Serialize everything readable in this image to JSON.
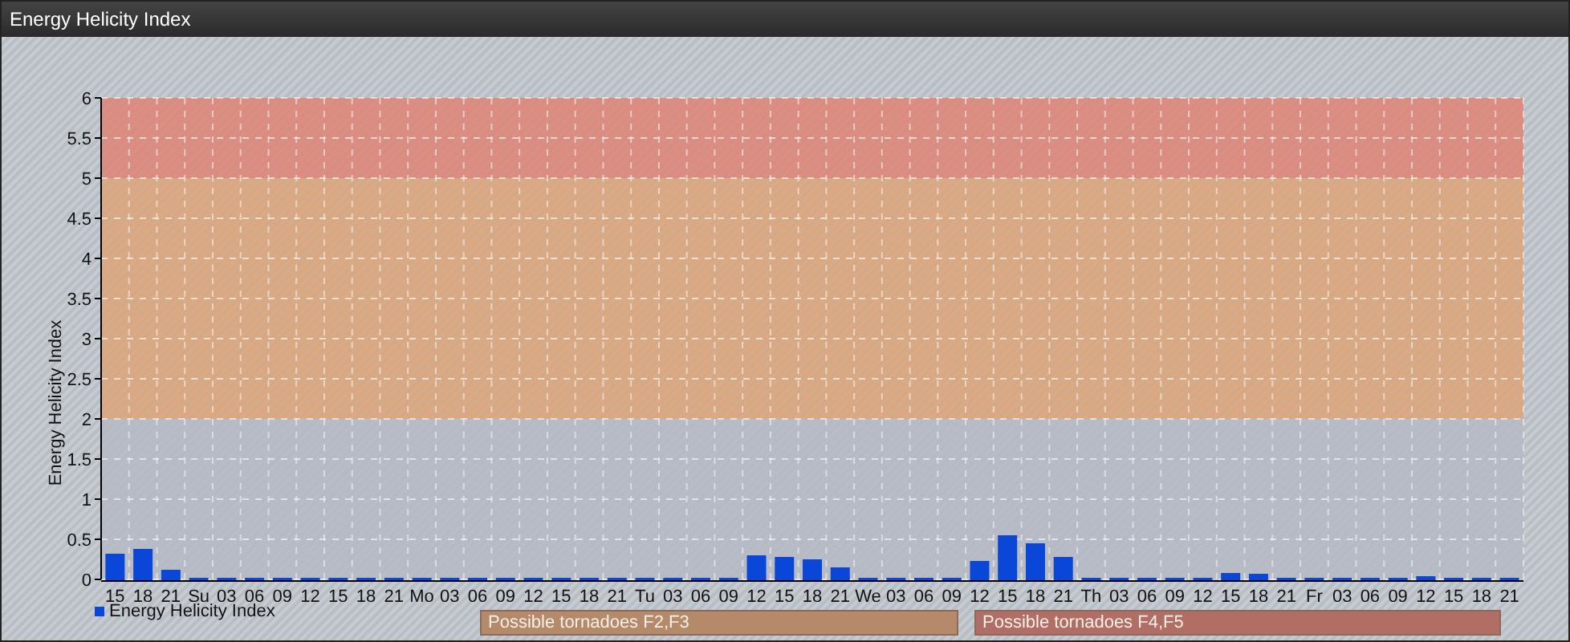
{
  "window": {
    "title": "Energy Helicity Index"
  },
  "chart": {
    "chart_data": {
      "type": "bar",
      "ylabel": "Energy Helicity Index",
      "categories": [
        "15",
        "18",
        "21",
        "Su",
        "03",
        "06",
        "09",
        "12",
        "15",
        "18",
        "21",
        "Mo",
        "03",
        "06",
        "09",
        "12",
        "15",
        "18",
        "21",
        "Tu",
        "03",
        "06",
        "09",
        "12",
        "15",
        "18",
        "21",
        "We",
        "03",
        "06",
        "09",
        "12",
        "15",
        "18",
        "21",
        "Th",
        "03",
        "06",
        "09",
        "12",
        "15",
        "18",
        "21",
        "Fr",
        "03",
        "06",
        "09",
        "12",
        "15",
        "18",
        "21"
      ],
      "series": [
        {
          "name": "Energy Helicity Index",
          "color": "#0a46d8",
          "values": [
            0.32,
            0.38,
            0.12,
            0.02,
            0.02,
            0.02,
            0.02,
            0.02,
            0.02,
            0.02,
            0.02,
            0.02,
            0.02,
            0.02,
            0.02,
            0.02,
            0.02,
            0.02,
            0.02,
            0.02,
            0.02,
            0.02,
            0.02,
            0.3,
            0.28,
            0.25,
            0.15,
            0.02,
            0.02,
            0.02,
            0.02,
            0.23,
            0.55,
            0.45,
            0.28,
            0.02,
            0.02,
            0.02,
            0.02,
            0.02,
            0.08,
            0.07,
            0.02,
            0.02,
            0.02,
            0.02,
            0.02,
            0.04,
            0.02,
            0.02,
            0.02
          ]
        }
      ],
      "ylim": [
        0,
        6
      ],
      "yticks": [
        0,
        0.5,
        1,
        1.5,
        2,
        2.5,
        3,
        3.5,
        4,
        4.5,
        5,
        5.5,
        6
      ],
      "grid": true,
      "bands": [
        {
          "axis": "y",
          "from": 0,
          "to": 2,
          "color": "#b4bac4"
        },
        {
          "axis": "y",
          "from": 2,
          "to": 5,
          "color": "#dca478"
        },
        {
          "axis": "y",
          "from": 5,
          "to": 6,
          "color": "#de8474"
        }
      ]
    },
    "zones": [
      {
        "label": "Possible tornadoes F2,F3",
        "color": "#b48a6a"
      },
      {
        "label": "Possible tornadoes F4,F5",
        "color": "#b06e64"
      }
    ]
  }
}
